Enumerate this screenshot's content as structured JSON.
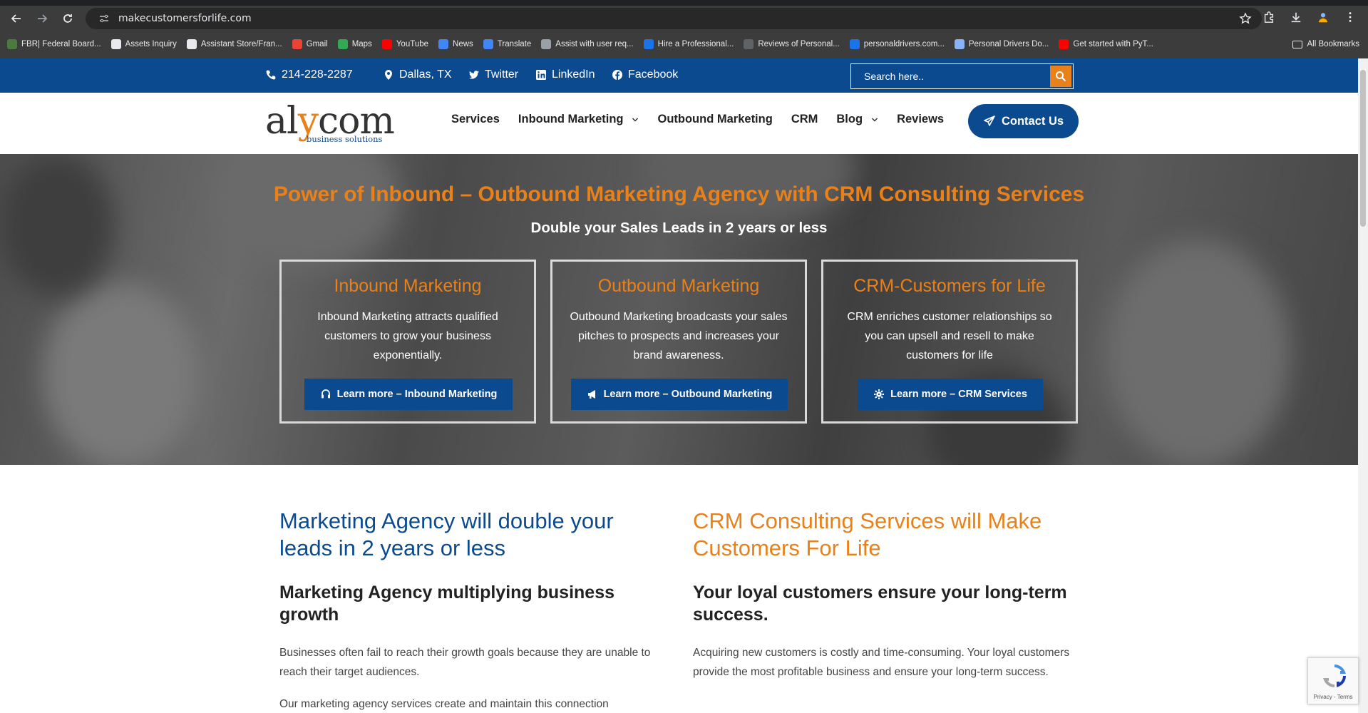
{
  "browser": {
    "url": "makecustomersforlife.com",
    "bookmarks": [
      {
        "label": "FBR| Federal Board...",
        "color": "#4a7a3d"
      },
      {
        "label": "Assets Inquiry",
        "color": "#e8eaed"
      },
      {
        "label": "Assistant Store/Fran...",
        "color": "#e8eaed"
      },
      {
        "label": "Gmail",
        "color": "#ea4335"
      },
      {
        "label": "Maps",
        "color": "#34a853"
      },
      {
        "label": "YouTube",
        "color": "#ff0000"
      },
      {
        "label": "News",
        "color": "#4285f4"
      },
      {
        "label": "Translate",
        "color": "#4285f4"
      },
      {
        "label": "Assist with user req...",
        "color": "#9aa0a6"
      },
      {
        "label": "Hire a Professional...",
        "color": "#1a73e8"
      },
      {
        "label": "Reviews of Personal...",
        "color": "#5f6368"
      },
      {
        "label": "personaldrivers.com...",
        "color": "#1a73e8"
      },
      {
        "label": "Personal Drivers Do...",
        "color": "#8ab4f8"
      },
      {
        "label": "Get started with PyT...",
        "color": "#ff0000"
      }
    ],
    "all_bookmarks": "All Bookmarks"
  },
  "topbar": {
    "phone": "214-228-2287",
    "location": "Dallas, TX",
    "twitter": "Twitter",
    "linkedin": "LinkedIn",
    "facebook": "Facebook",
    "search_placeholder": "Search here.."
  },
  "header": {
    "logo_main_a": "al",
    "logo_main_y": "y",
    "logo_main_b": "com",
    "logo_tag": "business solutions",
    "nav": {
      "services": "Services",
      "inbound": "Inbound Marketing",
      "outbound": "Outbound Marketing",
      "crm": "CRM",
      "blog": "Blog",
      "reviews": "Reviews"
    },
    "contact": "Contact Us"
  },
  "hero": {
    "title": "Power of Inbound – Outbound Marketing Agency with CRM Consulting Services",
    "subtitle": "Double your Sales Leads in 2 years or less",
    "cards": [
      {
        "title": "Inbound Marketing",
        "text": "Inbound Marketing attracts qualified customers to grow your business exponentially.",
        "button": "Learn more – Inbound Marketing"
      },
      {
        "title": "Outbound Marketing",
        "text": "Outbound Marketing broadcasts your sales pitches to prospects and increases your brand awareness.",
        "button": "Learn more – Outbound Marketing"
      },
      {
        "title": "CRM-Customers for Life",
        "text": "CRM enriches customer relationships so you can upsell and resell to make customers for life",
        "button": "Learn more – CRM Services"
      }
    ]
  },
  "content": {
    "left": {
      "heading": "Marketing Agency will double your leads in 2 years or less",
      "subheading": "Marketing Agency multiplying business growth",
      "p1": "Businesses often fail to reach their growth goals because they are unable to reach their target audiences.",
      "p2": "Our marketing agency services create and maintain this connection"
    },
    "right": {
      "heading": "CRM Consulting Services will Make Customers For Life",
      "subheading": "Your loyal customers ensure your long-term success.",
      "p1": "Acquiring new customers is costly and time-consuming. Your loyal customers provide the most profitable business and ensure your long-term success."
    }
  },
  "recaptcha": {
    "links": "Privacy - Terms"
  }
}
